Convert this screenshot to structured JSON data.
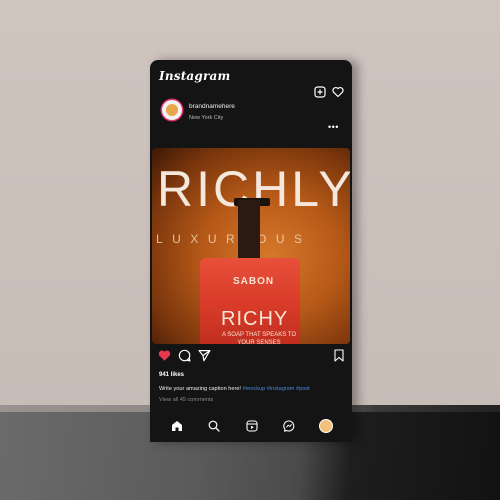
{
  "app": {
    "logo": "Instagram"
  },
  "header_icons": [
    "add-post-icon",
    "heart-icon"
  ],
  "post": {
    "username": "brandnamehere",
    "location": "New York City",
    "more": "•••",
    "image": {
      "title": "RICHLY",
      "subtitle": "LUXURIOUS",
      "bottle_brand": "SABON",
      "bottle_name": "RICHY",
      "bottle_tagline": "A SOAP THAT SPEAKS TO YOUR SENSES"
    },
    "likes": "941 likes",
    "caption_text": "Write your amazing caption here! ",
    "caption_hashtags": "#mockup #instagram #post",
    "comments_link": "View all 45 comments"
  },
  "actions": [
    "like-icon",
    "comment-icon",
    "share-icon",
    "save-icon"
  ],
  "nav": [
    "home-icon",
    "search-icon",
    "reels-icon",
    "messenger-icon",
    "profile-avatar"
  ],
  "colors": {
    "like": "#e53950",
    "hashtag": "#4b8ad8",
    "background": "#141414"
  }
}
